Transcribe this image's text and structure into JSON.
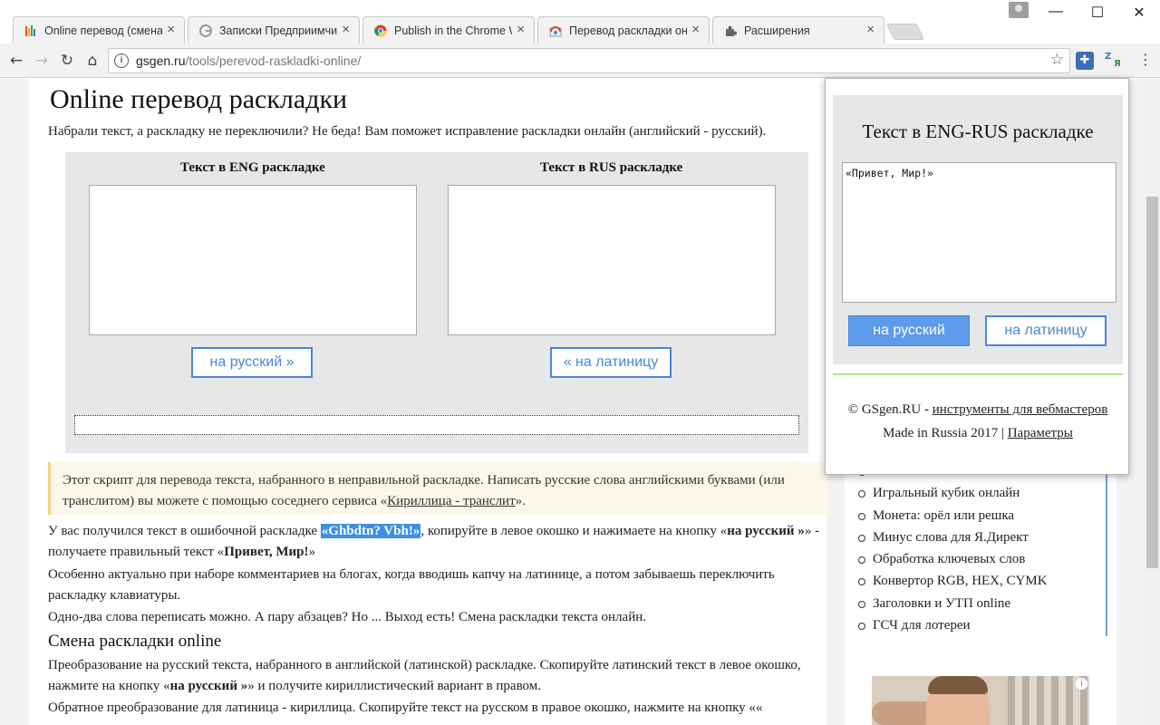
{
  "browser": {
    "tabs": [
      {
        "title": "Online перевод (смена)",
        "icon": "rainbow-bars-favicon"
      },
      {
        "title": "Записки Предприимчив",
        "icon": "grey-g-favicon"
      },
      {
        "title": "Publish in the Chrome W",
        "icon": "chrome-favicon"
      },
      {
        "title": "Перевод раскладки онл",
        "icon": "chrome-store-favicon"
      },
      {
        "title": "Расширения",
        "icon": "puzzle-favicon"
      }
    ],
    "url_host": "gsgen.ru",
    "url_path": "/tools/perevod-raskladki-online/"
  },
  "page": {
    "h1": "Online перевод раскладки",
    "intro": "Набрали текст, а раскладку не переключили? Не беда! Вам поможет исправление раскладки онлайн (английский - русский).",
    "eng_title": "Текст в ENG раскладке",
    "rus_title": "Текст в RUS раскладке",
    "btn_to_rus": "на русский »",
    "btn_to_lat": "« на латиницу",
    "note_text": "Этот скрипт для перевода текста, набранного в неправильной раскладке. Написать русские слова английскими буквами (или транслитом) вы можете с помощью соседнего сервиса «",
    "note_link": "Кириллица - транслит",
    "note_end": "».",
    "p1_a": "У вас получился текст в ошибочной раскладке ",
    "p1_hl": "«Ghbdtn? Vbh!»",
    "p1_b": ", копируйте в левое окошко и нажимаете на кнопку «",
    "p1_bold1": "на русский »",
    "p1_c": "» - получаете правильный текст «",
    "p1_bold2": "Привет, Мир!",
    "p1_d": "»",
    "p2": "Особенно актуально при наборе комментариев на блогах, когда вводишь капчу на латинице, а потом забываешь переключить раскладку клавиатуры.",
    "p3": "Одно-два слова переписать можно. А пару абзацев? Но ... Выход есть! Смена раскладки текста онлайн.",
    "h2": "Смена раскладки online",
    "p4_a": "Преобразование на русский текста, набранного в английской (латинской) раскладке. Скопируйте латинский текст в левое окошко, нажмите на кнопку «",
    "p4_bold": "на русский »",
    "p4_b": "» и получите кириллистический вариант в правом.",
    "p5": "Обратное преобразование для латиница - кириллица. Скопируйте текст на русском в правое окошко, нажмите на кнопку «« "
  },
  "sidebar": {
    "items": [
      "Игральный кубик онлайн",
      "Монета: орёл или решка",
      "Минус слова для Я.Директ",
      "Обработка ключевых слов",
      "Конвертор RGB, HEX, CYMK",
      "Заголовки и УТП online",
      "ГСЧ для лотереи"
    ]
  },
  "popup": {
    "title": "Текст в ENG-RUS раскладке",
    "textarea_value": "«Привет, Мир!»",
    "btn_rus": "на русский",
    "btn_lat": "на латиницу",
    "footer_prefix": "© GSgen.RU - ",
    "footer_link": "инструменты для вебмастеров",
    "made_in": "Made in Russia 2017 | ",
    "params_link": "Параметры"
  },
  "colors": {
    "accent": "#4a86d8",
    "highlight": "#3d8fe3",
    "tool_bg": "#e6e7e9"
  }
}
